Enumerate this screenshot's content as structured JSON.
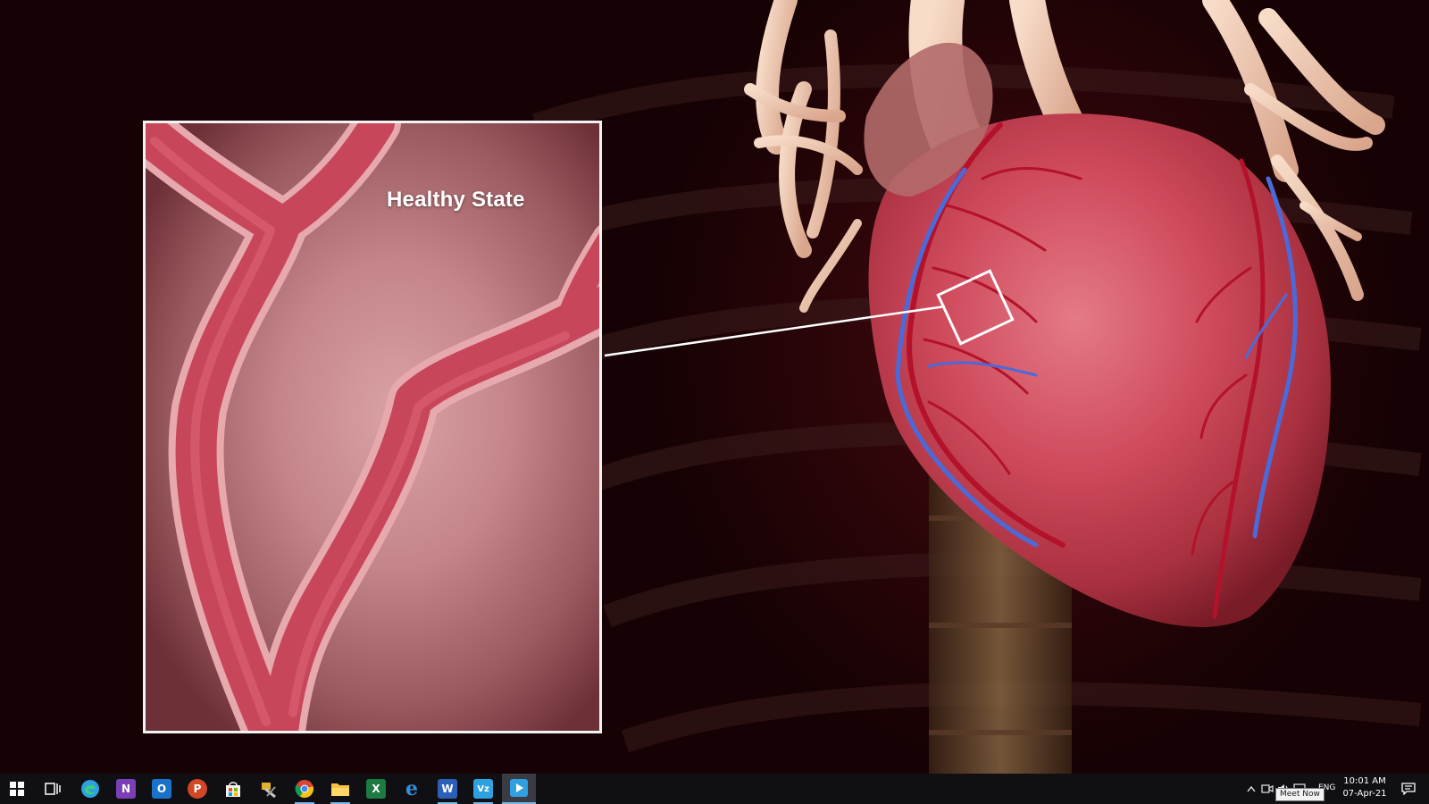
{
  "video": {
    "inset_title": "Healthy State"
  },
  "taskbar": {
    "apps": [
      {
        "name": "start",
        "icon": "windows-logo-icon"
      },
      {
        "name": "task-view",
        "icon": "task-view-icon"
      },
      {
        "name": "edge",
        "icon": "edge-icon",
        "color": "#2fa0e0"
      },
      {
        "name": "onenote",
        "icon": "onenote-icon",
        "letter": "N",
        "color": "#7b3fb5"
      },
      {
        "name": "outlook",
        "icon": "outlook-icon",
        "letter": "O",
        "color": "#1a73c8"
      },
      {
        "name": "powerpoint",
        "icon": "powerpoint-icon",
        "letter": "P",
        "color": "#d24726"
      },
      {
        "name": "store",
        "icon": "store-icon",
        "color": "#f2f2f2"
      },
      {
        "name": "tools",
        "icon": "tools-icon",
        "color": "#e0b030"
      },
      {
        "name": "chrome",
        "icon": "chrome-icon"
      },
      {
        "name": "file-explorer",
        "icon": "folder-icon",
        "color": "#f5c242"
      },
      {
        "name": "excel",
        "icon": "excel-icon",
        "letter": "X",
        "color": "#1d7a43"
      },
      {
        "name": "internet-explorer",
        "icon": "ie-icon",
        "letter": "e",
        "color": "#2f8fd8"
      },
      {
        "name": "word",
        "icon": "word-icon",
        "letter": "W",
        "color": "#2b5fb8"
      },
      {
        "name": "vz-app",
        "icon": "vz-icon",
        "letter": "Vz",
        "color": "#2fa0e0"
      },
      {
        "name": "media-player",
        "icon": "media-player-icon",
        "color": "#2fa0e0"
      }
    ],
    "tray": {
      "language": "ENG",
      "time": "10:01 AM",
      "date": "07-Apr-21",
      "tooltip": "Meet Now"
    }
  }
}
